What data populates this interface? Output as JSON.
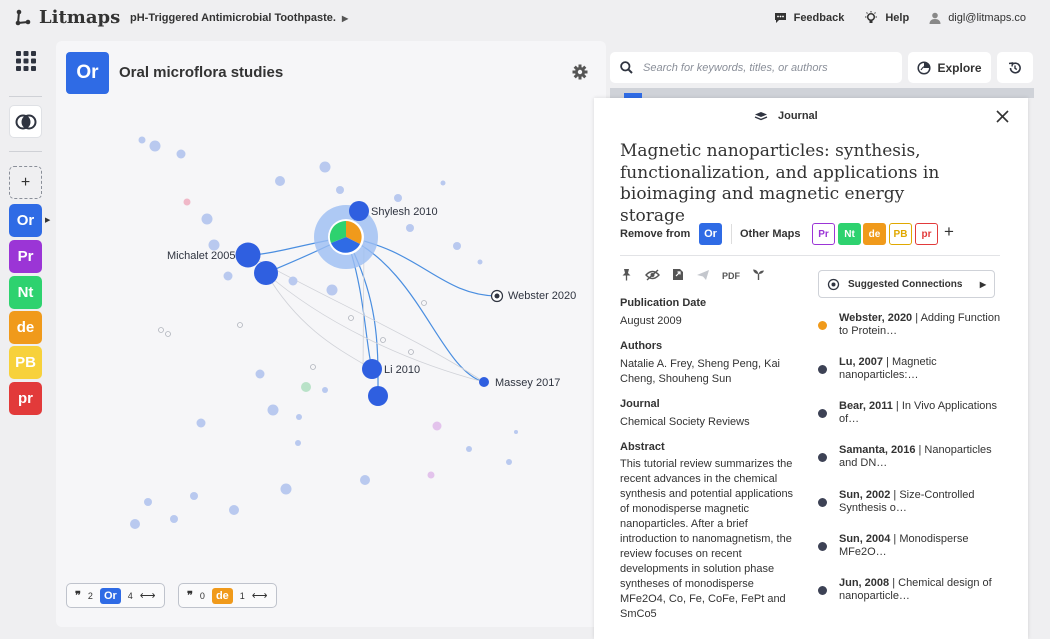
{
  "app": {
    "name": "Litmaps"
  },
  "breadcrumb": {
    "project": "pH-Triggered Antimicrobial Toothpaste."
  },
  "toplinks": {
    "feedback": "Feedback",
    "help": "Help",
    "account": "digl@litmaps.co"
  },
  "rail": {
    "add_label": "+",
    "maps": [
      {
        "abbr": "Or",
        "color": "#2f6be5"
      },
      {
        "abbr": "Pr",
        "color": "#9b35d6"
      },
      {
        "abbr": "Nt",
        "color": "#2ed26f"
      },
      {
        "abbr": "de",
        "color": "#f09a1b"
      },
      {
        "abbr": "PB",
        "color": "#f7d13b"
      },
      {
        "abbr": "pr",
        "color": "#e23a3a"
      }
    ]
  },
  "map": {
    "badge": "Or",
    "title": "Oral microflora studies",
    "node_labels": {
      "shylesh": "Shylesh 2010",
      "michalet": "Michalet 2005",
      "webster": "Webster 2020",
      "li": "Li 2010",
      "massey": "Massey 2017"
    },
    "counters": [
      {
        "quote_count": "2",
        "map": "Or",
        "map_color": "#2f6be5",
        "link_count": "4"
      },
      {
        "quote_count": "0",
        "map": "de",
        "map_color": "#f09a1b",
        "link_count": "1"
      }
    ]
  },
  "search": {
    "placeholder": "Search for keywords, titles, or authors"
  },
  "explore": {
    "label": "Explore"
  },
  "paper": {
    "type": "Journal",
    "title": "Magnetic nanoparticles: synthesis, functionalization, and applications in bioimaging and magnetic energy storage",
    "remove_from_label": "Remove from",
    "remove_from_map": "Or",
    "other_maps_label": "Other Maps",
    "other_maps": [
      {
        "abbr": "Pr",
        "color": "#9b35d6",
        "fill": "#fff"
      },
      {
        "abbr": "Nt",
        "color": "#fff",
        "fill": "#2ed26f"
      },
      {
        "abbr": "de",
        "color": "#fff",
        "fill": "#f09a1b"
      },
      {
        "abbr": "PB",
        "color": "#e0a800",
        "fill": "#fff"
      },
      {
        "abbr": "pr",
        "color": "#e23a3a",
        "fill": "#fff"
      }
    ],
    "add_label": "+",
    "pdf_label": "PDF",
    "publication_date_label": "Publication Date",
    "publication_date": "August 2009",
    "authors_label": "Authors",
    "authors": "Natalie A. Frey, Sheng Peng, Kai Cheng, Shouheng Sun",
    "journal_label": "Journal",
    "journal": "Chemical Society Reviews",
    "abstract_label": "Abstract",
    "abstract": "This tutorial review summarizes the recent advances in the chemical synthesis and potential applications of monodisperse magnetic nanoparticles. After a brief introduction to nanomagnetism, the review focuses on recent developments in solution phase syntheses of monodisperse MFe2O4, Co, Fe, CoFe, FePt and SmCo5"
  },
  "suggested": {
    "label": "Suggested Connections",
    "items": [
      {
        "author": "Webster, 2020",
        "title": "Adding Function to Protein…",
        "dot": "#f09a1b"
      },
      {
        "author": "Lu, 2007",
        "title": "Magnetic nanoparticles:…",
        "dot": "#3d4255"
      },
      {
        "author": "Bear, 2011",
        "title": "In Vivo Applications of…",
        "dot": "#3d4255"
      },
      {
        "author": "Samanta, 2016",
        "title": "Nanoparticles and DN…",
        "dot": "#3d4255"
      },
      {
        "author": "Sun, 2002",
        "title": "Size-Controlled Synthesis o…",
        "dot": "#3d4255"
      },
      {
        "author": "Sun, 2004",
        "title": "Monodisperse MFe2O…",
        "dot": "#3d4255"
      },
      {
        "author": "Jun, 2008",
        "title": "Chemical design of nanoparticle…",
        "dot": "#3d4255"
      }
    ]
  }
}
